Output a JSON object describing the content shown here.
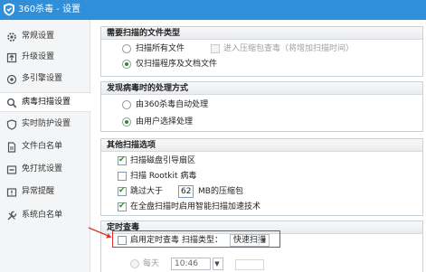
{
  "window": {
    "title": "360杀毒 - 设置"
  },
  "sidebar": {
    "items": [
      {
        "label": "常规设置",
        "icon": "gear-icon"
      },
      {
        "label": "升级设置",
        "icon": "upgrade-icon"
      },
      {
        "label": "多引擎设置",
        "icon": "engines-icon"
      },
      {
        "label": "病毒扫描设置",
        "icon": "scan-magnifier-icon",
        "active": true
      },
      {
        "label": "实时防护设置",
        "icon": "shield-icon"
      },
      {
        "label": "文件白名单",
        "icon": "file-whitelist-icon"
      },
      {
        "label": "免打扰设置",
        "icon": "do-not-disturb-icon"
      },
      {
        "label": "异常提醒",
        "icon": "alert-icon"
      },
      {
        "label": "系统白名单",
        "icon": "tools-icon"
      }
    ]
  },
  "file_types": {
    "title": "需要扫描的文件类型",
    "scan_all_label": "扫描所有文件",
    "archive_label": "进入压缩包查毒（将增加扫描时间）",
    "programs_docs_label": "仅扫描程序及文档文件"
  },
  "on_virus": {
    "title": "发现病毒时的处理方式",
    "auto_label": "由360杀毒自动处理",
    "user_label": "由用户选择处理"
  },
  "other_options": {
    "title": "其他扫描选项",
    "boot_sector_label": "扫描磁盘引导扇区",
    "rootkit_label": "扫描 Rootkit 病毒",
    "skip_prefix": "跳过大于",
    "skip_value": "62",
    "skip_suffix": "MB的压缩包",
    "smart_label": "在全盘扫描时启用智能扫描加速技术"
  },
  "scheduled": {
    "title": "定时查毒",
    "enable_label": "启用定时查毒",
    "scan_type_label": "扫描类型：",
    "scan_type_value": "快速扫描",
    "daily_label": "每天",
    "time_value": "10:46"
  },
  "colors": {
    "titlebar": "#2f8fd8",
    "annotation_red": "#d9312b",
    "check_green": "#2a8c2a"
  }
}
